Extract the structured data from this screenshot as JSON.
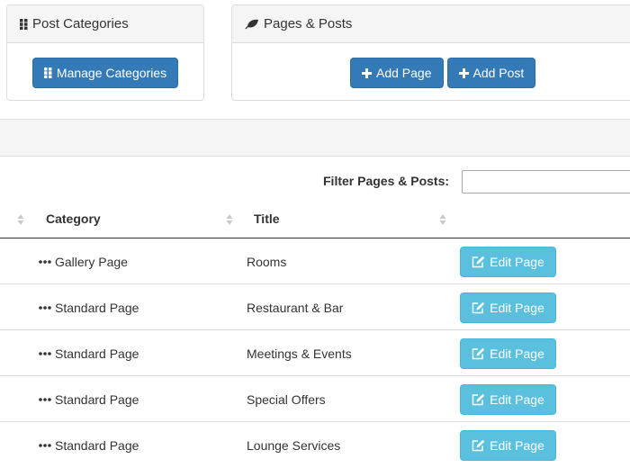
{
  "post_categories": {
    "heading": "Post Categories",
    "heading_icon": "grid-icon",
    "button_label": "Manage Categories",
    "button_icon": "grid-icon"
  },
  "pages_posts": {
    "heading": "Pages & Posts",
    "heading_icon": "leaf-icon",
    "add_page_label": "Add Page",
    "add_post_label": "Add Post",
    "button_icon": "plus-icon"
  },
  "filter": {
    "label": "Filter Pages & Posts:",
    "value": ""
  },
  "table": {
    "columns": [
      "Category",
      "Title"
    ],
    "edit_label": "Edit Page",
    "edit_icon": "edit-icon",
    "rows": [
      {
        "category": "Gallery Page",
        "title": "Rooms"
      },
      {
        "category": "Standard Page",
        "title": "Restaurant & Bar"
      },
      {
        "category": "Standard Page",
        "title": "Meetings & Events"
      },
      {
        "category": "Standard Page",
        "title": "Special Offers"
      },
      {
        "category": "Standard Page",
        "title": "Lounge Services"
      }
    ]
  },
  "colors": {
    "primary": "#337ab7",
    "info": "#5bc0de",
    "panel_bg": "#f5f5f5",
    "border": "#dddddd"
  }
}
